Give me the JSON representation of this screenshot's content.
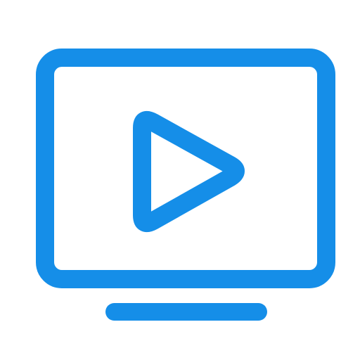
{
  "icon": {
    "name": "tv-play-icon",
    "stroke_color": "#158EE8",
    "background_color": "#FFFFFF"
  }
}
